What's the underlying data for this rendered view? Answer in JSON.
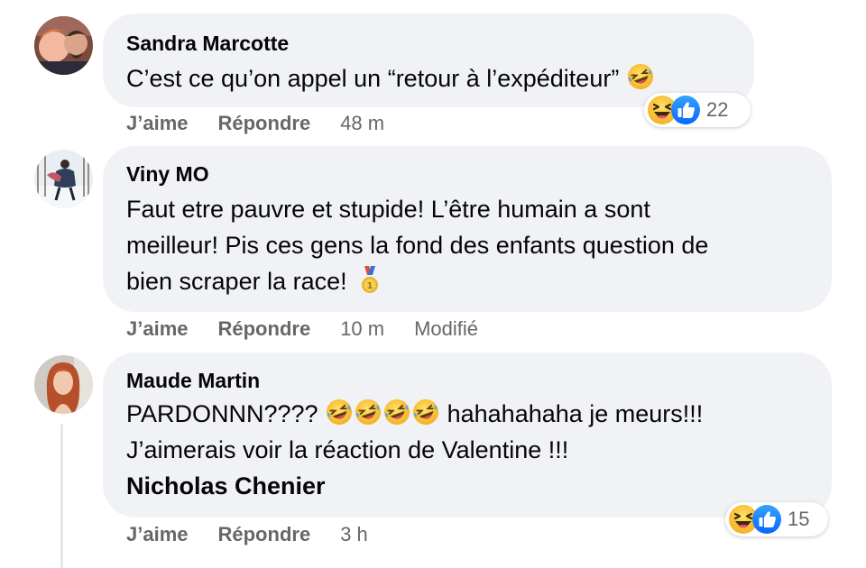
{
  "comments": [
    {
      "author": "Sandra Marcotte",
      "text_before": "C’est ce qu’on appel un “retour à l’expéditeur”",
      "like_label": "J’aime",
      "reply_label": "Répondre",
      "time": "48 m",
      "reaction_count": "22",
      "reaction_icons": [
        "laughing-icon",
        "like-icon"
      ]
    },
    {
      "author": "Viny MO",
      "lines": [
        "Faut etre pauvre et stupide! L’être humain a sont",
        "meilleur! Pis ces gens la fond des enfants question de",
        "bien scraper la race!"
      ],
      "like_label": "J’aime",
      "reply_label": "Répondre",
      "time": "10 m",
      "edited": "Modifié"
    },
    {
      "author": "Maude Martin",
      "line1_before": "PARDONNN????",
      "line1_after": "hahahahaha je meurs!!!",
      "line2": "J’aimerais voir la réaction de Valentine !!!",
      "mention": "Nicholas Chenier",
      "like_label": "J’aime",
      "reply_label": "Répondre",
      "time": "3 h",
      "reaction_count": "15",
      "reaction_icons": [
        "laughing-icon",
        "like-icon"
      ]
    }
  ],
  "colors": {
    "bubble": "#f0f2f5",
    "secondary_text": "#65676b",
    "like_blue": "#1877f2",
    "emoji_yellow": "#fbc536"
  }
}
